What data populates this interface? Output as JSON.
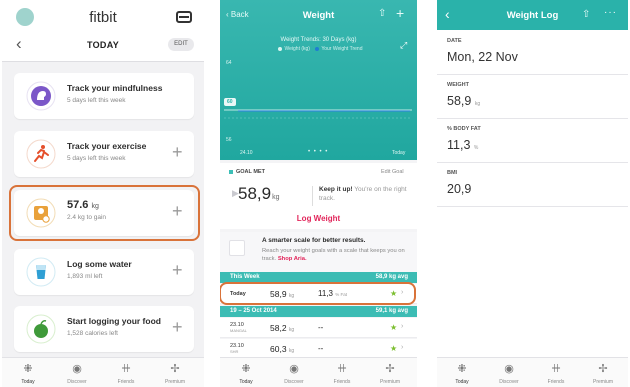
{
  "today": {
    "brand": "fitbit",
    "back_glyph": "‹",
    "section_title": "TODAY",
    "edit_label": "EDIT",
    "cards": [
      {
        "icon": "mindfulness-icon",
        "title": "Track your mindfulness",
        "subtitle": "5 days left this week",
        "plus": false
      },
      {
        "icon": "exercise-icon",
        "title": "Track your exercise",
        "subtitle": "5 days left this week",
        "plus": true
      },
      {
        "icon": "weight-scale-icon",
        "title_value": "57.6",
        "title_unit": "kg",
        "subtitle": "2.4 kg to gain",
        "plus": true,
        "highlighted": true
      },
      {
        "icon": "water-icon",
        "title": "Log some water",
        "subtitle": "1,893 ml left",
        "plus": true
      },
      {
        "icon": "food-icon",
        "title": "Start logging your food",
        "subtitle": "1,528 calories left",
        "plus": true
      }
    ],
    "plus_glyph": "+",
    "tabs": [
      {
        "icon": "today-icon",
        "label": "Today",
        "glyph": "⁜"
      },
      {
        "icon": "discover-icon",
        "label": "Discover",
        "glyph": "◉"
      },
      {
        "icon": "friends-icon",
        "label": "Friends",
        "glyph": "ꔠ"
      },
      {
        "icon": "premium-icon",
        "label": "Premium",
        "glyph": "✢"
      }
    ]
  },
  "weight": {
    "back_label": "‹ Back",
    "title": "Weight",
    "share_glyph": "⇧",
    "add_glyph": "+",
    "expand_glyph": "⤢",
    "trend_title": "Weight Trends: 30 Days (kg)",
    "legend": [
      {
        "label": "Weight (kg)",
        "color": "#d9f4ef"
      },
      {
        "label": "Your Weight Trend",
        "color": "#1f7fd1"
      }
    ],
    "chart_ticks": {
      "top": "64",
      "goal_marker": "60",
      "bottom": "56"
    },
    "chart_x_left": "24.10",
    "chart_x_right": "Today",
    "page_dots": "• • • •",
    "goal_status": "GOAL MET",
    "edit_goal": "Edit Goal",
    "current_value": "58,9",
    "current_unit": "kg",
    "keep_it_up_bold": "Keep it up!",
    "keep_it_up_rest": " You're on the right track.",
    "log_weight": "Log Weight",
    "scale_title": "A smarter scale for better results.",
    "scale_desc": "Reach your weight goals with a scale that keeps you on track.",
    "scale_link": "Shop Aria.",
    "this_week_label": "This Week",
    "this_week_avg": "58,9 kg avg",
    "week_rows": [
      {
        "date": "Today",
        "weight": "58,9",
        "unit": "kg",
        "fat": "11,3",
        "fat_unit": "% Fat",
        "star": "★",
        "chev": "›"
      }
    ],
    "range_label": "19 – 25 Oct 2014",
    "range_avg": "59,1 kg avg",
    "range_rows": [
      {
        "date": "23.10",
        "day": "MANGAL",
        "weight": "58,2",
        "unit": "kg",
        "fat": "--",
        "star": "★",
        "chev": "›"
      },
      {
        "date": "23.10",
        "day": "SHR",
        "weight": "60,3",
        "unit": "kg",
        "fat": "--",
        "star": "★",
        "chev": "›"
      }
    ]
  },
  "log": {
    "back_glyph": "‹",
    "title": "Weight Log",
    "share_glyph": "⇧",
    "more_glyph": "···",
    "fields": [
      {
        "label": "DATE",
        "value": "Mon, 22 Nov",
        "unit": ""
      },
      {
        "label": "WEIGHT",
        "value": "58,9",
        "unit": "kg"
      },
      {
        "label": "% BODY FAT",
        "value": "11,3",
        "unit": "%"
      },
      {
        "label": "BMI",
        "value": "20,9",
        "unit": ""
      }
    ]
  },
  "colors": {
    "accent_teal": "#2ab2aa",
    "highlight_orange": "#d9733a",
    "link_pink": "#e2265b",
    "star_green": "#7bbe2e"
  }
}
